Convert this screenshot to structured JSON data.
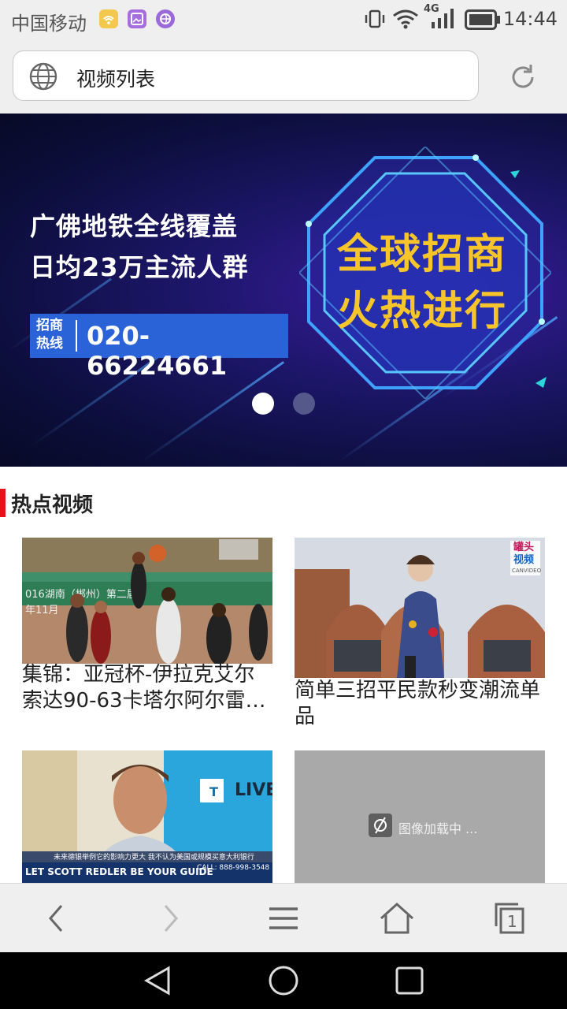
{
  "status_bar": {
    "carrier": "中国移动",
    "network": "4G",
    "time": "14:44"
  },
  "address_bar": {
    "url_title": "视频列表"
  },
  "banner": {
    "line1": "广佛地铁全线覆盖",
    "line2": "日均23万主流人群",
    "hotline_label": "招商热线",
    "hotline_number": "020-66224661",
    "badge_line1": "全球招商",
    "badge_line2": "火热进行",
    "active_slide": 1,
    "slide_count": 2
  },
  "section": {
    "title": "热点视频"
  },
  "videos": [
    {
      "caption": "集锦：亚冠杯-伊拉克艾尔索达90-63卡塔尔阿尔雷…",
      "thumb": "basketball"
    },
    {
      "caption": "简单三招平民款秒变潮流单品",
      "thumb": "fashion",
      "watermark_line1": "罐头",
      "watermark_line2": "视频",
      "watermark_line3": "CANVIDEO"
    },
    {
      "caption": "",
      "thumb": "news",
      "overlay_logo": "LIVE",
      "ticker": "LET SCOTT REDLER BE YOUR GUIDE",
      "ticker_phone": "CALL: 888-998-3548",
      "subtitle": "未来德银举例它的影响力更大 我不认为美国或规模买意大利银行"
    },
    {
      "caption": "",
      "thumb": "loading",
      "loading_text": "图像加载中 ..."
    }
  ],
  "bottom_nav": {
    "tab_count": "1"
  },
  "colors": {
    "accent": "#e8101b",
    "badge_text": "#f7c429",
    "hotline_bg": "#2a63d8"
  }
}
